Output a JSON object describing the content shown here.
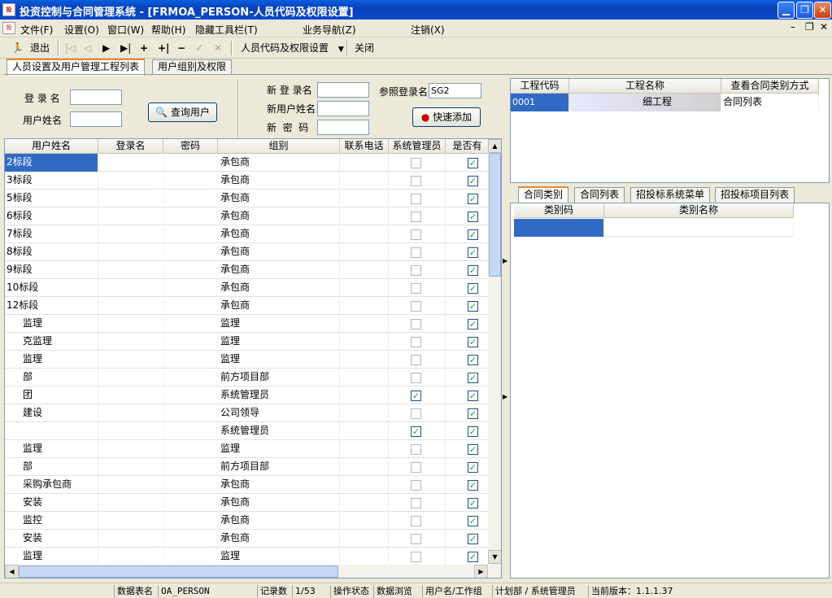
{
  "window": {
    "title": "投资控制与合同管理系统 - [FRMOA_PERSON-人员代码及权限设置]",
    "icon": "app-logo"
  },
  "menubar": {
    "items": [
      "文件(F)",
      "设置(O)",
      "窗口(W)",
      "帮助(H)",
      "隐藏工具栏(T)",
      "业务导航(Z)",
      "注销(X)"
    ]
  },
  "toolbar": {
    "exit": "退出",
    "form_select": "人员代码及权限设置",
    "close": "关闭"
  },
  "tabs": {
    "main": [
      "人员设置及用户管理工程列表",
      "用户组别及权限"
    ]
  },
  "search": {
    "login_label": "登 录 名",
    "username_label": "用户姓名",
    "query_button": "查询用户",
    "login_value": "",
    "username_value": ""
  },
  "add": {
    "new_login_label": "新 登 录名",
    "new_username_label": "新用户姓名",
    "new_password_label": "新  密  码",
    "ref_login_label": "参照登录名",
    "ref_login_value": "SG2",
    "quick_add_button": "快速添加"
  },
  "users_table": {
    "columns": [
      "用户姓名",
      "登录名",
      "密码",
      "组别",
      "联系电话",
      "系统管理员",
      "是否有"
    ],
    "rows": [
      {
        "name": "2标段",
        "group": "承包商",
        "admin": false,
        "flag": true
      },
      {
        "name": "3标段",
        "group": "承包商",
        "admin": false,
        "flag": true
      },
      {
        "name": "5标段",
        "group": "承包商",
        "admin": false,
        "flag": true
      },
      {
        "name": "6标段",
        "group": "承包商",
        "admin": false,
        "flag": true
      },
      {
        "name": "7标段",
        "group": "承包商",
        "admin": false,
        "flag": true
      },
      {
        "name": "8标段",
        "group": "承包商",
        "admin": false,
        "flag": true
      },
      {
        "name": "9标段",
        "group": "承包商",
        "admin": false,
        "flag": true
      },
      {
        "name": "10标段",
        "group": "承包商",
        "admin": false,
        "flag": true
      },
      {
        "name": "12标段",
        "group": "承包商",
        "admin": false,
        "flag": true
      },
      {
        "name": "监理",
        "group": "监理",
        "admin": false,
        "flag": true
      },
      {
        "name": "克监理",
        "group": "监理",
        "admin": false,
        "flag": true
      },
      {
        "name": "监理",
        "group": "监理",
        "admin": false,
        "flag": true
      },
      {
        "name": "部",
        "group": "前方项目部",
        "admin": false,
        "flag": true
      },
      {
        "name": "团",
        "group": "系统管理员",
        "admin": true,
        "flag": true
      },
      {
        "name": "建设",
        "group": "公司领导",
        "admin": false,
        "flag": true
      },
      {
        "name": "",
        "group": "系统管理员",
        "admin": true,
        "flag": true
      },
      {
        "name": "监理",
        "group": "监理",
        "admin": false,
        "flag": true
      },
      {
        "name": "部",
        "group": "前方项目部",
        "admin": false,
        "flag": true
      },
      {
        "name": "采购承包商",
        "group": "承包商",
        "admin": false,
        "flag": true
      },
      {
        "name": "安装",
        "group": "承包商",
        "admin": false,
        "flag": true
      },
      {
        "name": "监控",
        "group": "承包商",
        "admin": false,
        "flag": true
      },
      {
        "name": "安装",
        "group": "承包商",
        "admin": false,
        "flag": true
      },
      {
        "name": "监理",
        "group": "监理",
        "admin": false,
        "flag": true
      }
    ]
  },
  "projects_table": {
    "columns": [
      "工程代码",
      "工程名称",
      "查看合同类别方式"
    ],
    "rows": [
      {
        "code": "0001",
        "name": "细工程",
        "mode": "合同列表"
      }
    ]
  },
  "subtabs": [
    "合同类别",
    "合同列表",
    "招投标系统菜单",
    "招投标项目列表"
  ],
  "category_table": {
    "columns": [
      "类别码",
      "类别名称"
    ]
  },
  "statusbar": {
    "table_label": "数据表名",
    "table_value": "OA_PERSON",
    "records_label": "记录数",
    "records_value": "1/53",
    "state_label": "操作状态",
    "state_value": "数据浏览",
    "user_label": "用户名/工作组",
    "user_value": "计划部 / 系统管理员",
    "version": "当前版本：1.1.1.37"
  },
  "colors": {
    "accent": "#316ac5",
    "title_bar": "#0a5fe0",
    "tab_active": "#e68b2c"
  }
}
